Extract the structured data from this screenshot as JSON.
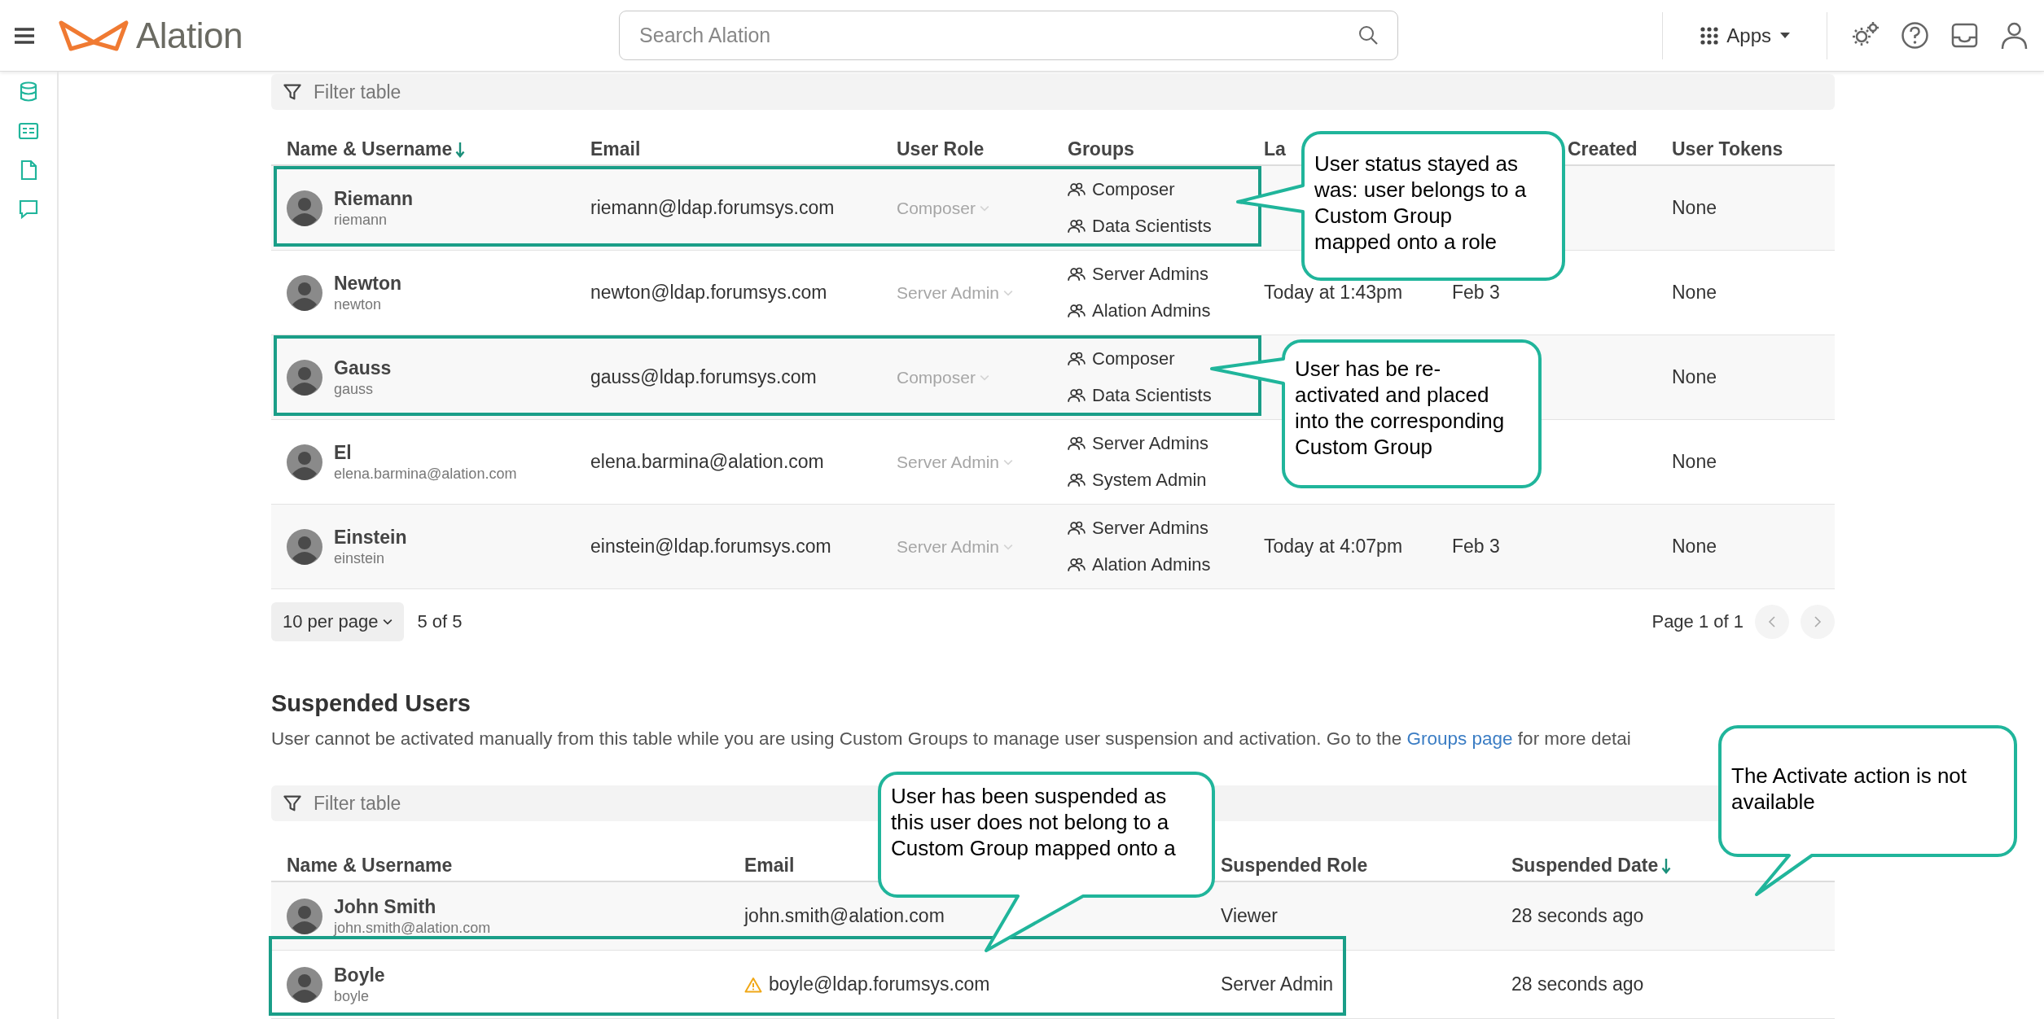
{
  "header": {
    "logo": "Alation",
    "search": {
      "placeholder": "Search Alation"
    },
    "apps_button": "Apps"
  },
  "users_table": {
    "filter": {
      "placeholder": "Filter table"
    },
    "columns": [
      {
        "label": "Name & Username",
        "sorted": true
      },
      {
        "label": "Email",
        "sorted": false
      },
      {
        "label": "User Role",
        "sorted": false
      },
      {
        "label": "Groups",
        "sorted": false
      },
      {
        "label": "La",
        "sorted": false
      },
      {
        "label": "Created",
        "sorted": false
      },
      {
        "label": "User Tokens",
        "sorted": false
      }
    ],
    "rows": [
      {
        "name": "Riemann",
        "username": "riemann",
        "email": "riemann@ldap.forumsys.com",
        "role": "Composer",
        "role_disabled": true,
        "groups": [
          "Composer",
          "Data Scientists"
        ],
        "tokens": "None",
        "highlighted": true
      },
      {
        "name": "Newton",
        "username": "newton",
        "email": "newton@ldap.forumsys.com",
        "role": "Server Admin",
        "role_disabled": true,
        "groups": [
          "Server Admins",
          "Alation Admins"
        ],
        "last_login": "Today at 1:43pm",
        "created": "Feb 3",
        "tokens": "None",
        "highlighted": false
      },
      {
        "name": "Gauss",
        "username": "gauss",
        "email": "gauss@ldap.forumsys.com",
        "role": "Composer",
        "role_disabled": true,
        "groups": [
          "Composer",
          "Data Scientists"
        ],
        "tokens": "None",
        "highlighted": true
      },
      {
        "name": "El",
        "username": "elena.barmina@alation.com",
        "email": "elena.barmina@alation.com",
        "role": "Server Admin",
        "role_disabled": true,
        "groups": [
          "Server Admins",
          "System Admin"
        ],
        "tokens": "None",
        "highlighted": false
      },
      {
        "name": "Einstein",
        "username": "einstein",
        "email": "einstein@ldap.forumsys.com",
        "role": "Server Admin",
        "role_disabled": true,
        "groups": [
          "Server Admins",
          "Alation Admins"
        ],
        "last_login": "Today at 4:07pm",
        "created": "Feb 3",
        "tokens": "None",
        "highlighted": false
      }
    ],
    "pagination": {
      "page_size": "10 per page",
      "count": "5 of 5",
      "page": "Page 1 of 1"
    }
  },
  "suspended_users": {
    "title": "Suspended Users",
    "description": "User cannot be activated manually from this table while you are using Custom Groups to manage user suspension and activation. Go to the ",
    "link": "Groups page",
    "description_end": " for more detai",
    "filter": {
      "placeholder": "Filter table"
    },
    "columns": [
      {
        "label": "Name & Username",
        "sorted": false
      },
      {
        "label": "Email",
        "sorted": false
      },
      {
        "label": "Suspended Role",
        "sorted": false
      },
      {
        "label": "Suspended Date",
        "sorted": true
      }
    ],
    "rows": [
      {
        "name": "John Smith",
        "username": "john.smith@alation.com",
        "email": "john.smith@alation.com",
        "warning": false,
        "role": "Viewer",
        "date": "28 seconds ago",
        "highlighted": false
      },
      {
        "name": "Boyle",
        "username": "boyle",
        "email": "boyle@ldap.forumsys.com",
        "warning": true,
        "role": "Server Admin",
        "date": "28 seconds ago",
        "highlighted": true
      }
    ]
  },
  "callouts": [
    {
      "text": "User status stayed as\nwas: user belongs to a\nCustom Group\nmapped onto a role"
    },
    {
      "text": "User has be re-\nactivated and placed\ninto the corresponding\nCustom Group"
    },
    {
      "text": "User has been suspended as\nthis user does not belong to a\nCustom Group mapped onto a"
    },
    {
      "text": "The Activate action is not\navailable"
    }
  ]
}
